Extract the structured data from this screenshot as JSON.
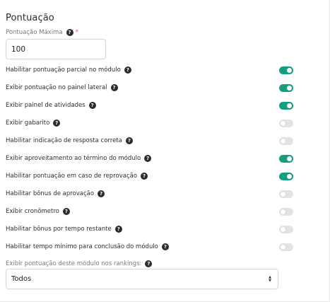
{
  "section": {
    "title": "Pontuação"
  },
  "max_score": {
    "label": "Pontuação Máxima",
    "required_mark": "*",
    "value": "100"
  },
  "settings": [
    {
      "label": "Habilitar pontuação parcial no módulo",
      "enabled": true
    },
    {
      "label": "Exibir pontuação no painel lateral",
      "enabled": true
    },
    {
      "label": "Exibir painel de atividades",
      "enabled": true
    },
    {
      "label": "Exibir gabarito",
      "enabled": false
    },
    {
      "label": "Habilitar indicação de resposta correta",
      "enabled": false
    },
    {
      "label": "Exibir aproveitamento ao término do módulo",
      "enabled": true
    },
    {
      "label": "Habilitar pontuação em caso de reprovação",
      "enabled": true
    },
    {
      "label": "Habilitar bônus de aprovação",
      "enabled": false
    },
    {
      "label": "Exibir cronômetro",
      "enabled": false
    },
    {
      "label": "Habilitar bônus por tempo restante",
      "enabled": false
    },
    {
      "label": "Habilitar tempo mínimo para conclusão do módulo",
      "enabled": false
    }
  ],
  "ranking": {
    "label": "Exibir pontuação deste módulo nos rankings:",
    "selected": "Todos"
  },
  "icons": {
    "help": "question-circle-icon",
    "select_arrows": "updown-arrows-icon"
  },
  "colors": {
    "toggle_on": "#139e84",
    "toggle_off": "#e3e3e3",
    "required": "#e05b5b"
  }
}
